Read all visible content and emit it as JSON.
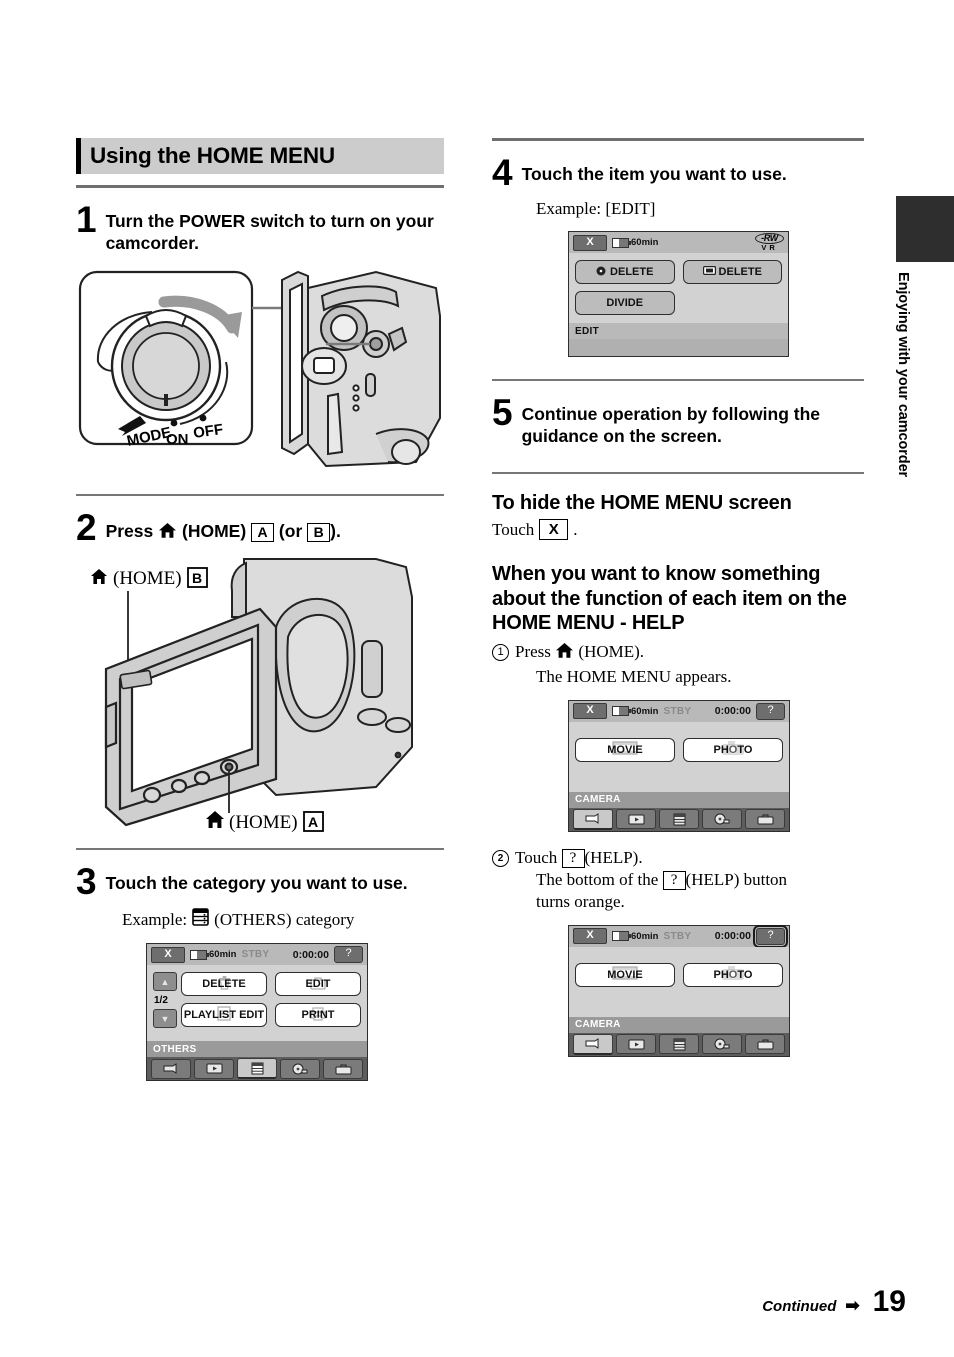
{
  "section": {
    "title": "Using the HOME MENU"
  },
  "steps": [
    {
      "num": "1",
      "text": "Turn the POWER switch to turn on your camcorder.",
      "figure_labels": {
        "mode": "MODE",
        "on": "ON",
        "off": "OFF"
      }
    },
    {
      "num": "2",
      "text_before": "Press",
      "text_home": "(HOME)",
      "label_a": "A",
      "text_or": "(or",
      "label_b": "B",
      "text_end": ").",
      "callout_top": "(HOME)",
      "callout_top_label": "B",
      "callout_bottom": "(HOME)",
      "callout_bottom_label": "A"
    },
    {
      "num": "3",
      "text": "Touch the category you want to use.",
      "example_prefix": "Example:",
      "example_suffix": "(OTHERS) category"
    },
    {
      "num": "4",
      "text": "Touch the item you want to use.",
      "example": "Example: [EDIT]"
    },
    {
      "num": "5",
      "text": "Continue operation by following the guidance on the screen."
    }
  ],
  "hide_section": {
    "heading": "To hide the HOME MENU screen",
    "body_prefix": "Touch",
    "button": "X",
    "body_suffix": "."
  },
  "help_section": {
    "heading": "When you want to know something about the function of each item on the HOME MENU - HELP",
    "item1": {
      "marker": "1",
      "line1_prefix": "Press",
      "line1_suffix": "(HOME).",
      "line2": "The HOME MENU appears."
    },
    "item2": {
      "marker": "2",
      "line1_prefix": "Touch",
      "line1_button": "?",
      "line1_suffix": "(HELP).",
      "line2_prefix": "The bottom of the",
      "line2_button": "?",
      "line2_suffix": "(HELP) button",
      "line3": "turns orange."
    }
  },
  "lcd_others": {
    "close": "X",
    "battery": "60min",
    "status": "STBY",
    "timecode": "0:00:00",
    "help": "?",
    "page": "1/2",
    "up": "▲",
    "down": "▼",
    "buttons": [
      "DELETE",
      "EDIT",
      "PLAYLIST EDIT",
      "PRINT"
    ],
    "category": "OTHERS",
    "tabs": [
      "camera-icon",
      "view-images-icon",
      "others-icon",
      "manage-media-icon",
      "settings-icon"
    ],
    "selected_tab": 2
  },
  "lcd_edit": {
    "close": "X",
    "battery": "60min",
    "disc": "-RW",
    "disc_mode": "VR",
    "buttons": [
      "DELETE",
      "DELETE",
      "DIVIDE"
    ],
    "category": "EDIT"
  },
  "lcd_camera_1": {
    "close": "X",
    "battery": "60min",
    "status": "STBY",
    "timecode": "0:00:00",
    "help": "?",
    "buttons": [
      "MOVIE",
      "PHOTO"
    ],
    "category": "CAMERA",
    "selected_tab": 0
  },
  "lcd_camera_2": {
    "close": "X",
    "battery": "60min",
    "status": "STBY",
    "timecode": "0:00:00",
    "help": "?",
    "help_highlighted": true,
    "buttons": [
      "MOVIE",
      "PHOTO"
    ],
    "category": "CAMERA",
    "selected_tab": 0
  },
  "side_tab": {
    "text": "Enjoying with your camcorder"
  },
  "footer": {
    "continued": "Continued",
    "arrow": "➡",
    "page": "19"
  },
  "colors": {
    "band": "#cccccc",
    "rule": "#6f6f6f",
    "lcd_bg": "#d2d2d2",
    "lcd_statusbar": "#b9b9b9",
    "lcd_catbar": "#9a9a9a",
    "lcd_tabrow": "#5d5d5d",
    "sidetab": "#2e2e2e"
  }
}
